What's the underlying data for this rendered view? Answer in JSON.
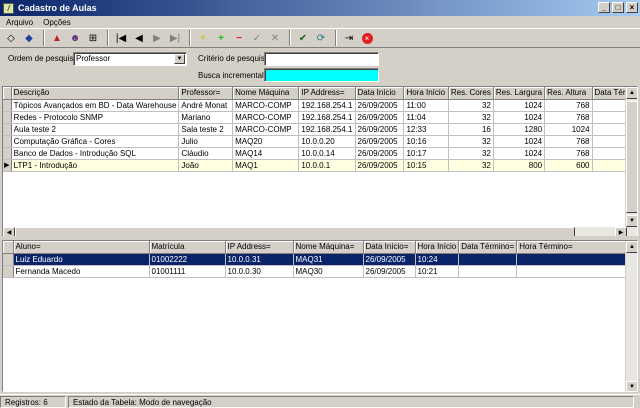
{
  "window": {
    "title": "Cadastro de Aulas"
  },
  "menu": [
    "Arquivo",
    "Opções"
  ],
  "filters": {
    "order_label": "Ordem de pesquisa:",
    "order_value": "Professor",
    "criteria_label": "Critério de pesquisa:",
    "criteria_value": "",
    "incremental_label": "Busca incremental:",
    "incremental_value": ""
  },
  "colors": {
    "incremental_bg": "#00ffff",
    "selection": "#0a246a",
    "current_row": "#ffffe1",
    "delete_icon": "#e02020",
    "add_icon": "#20c020"
  },
  "classes_grid": {
    "columns": [
      "Descrição",
      "Professor",
      "Nome Máquina",
      "IP Address",
      "Data Início",
      "Hora Início",
      "Res. Cores",
      "Res. Largura",
      "Res. Altura",
      "Data Térmi"
    ],
    "rows": [
      [
        "Tópicos Avançados em BD - Data Warehouse",
        "André Monat",
        "MARCO-COMP",
        "192.168.254.1",
        "26/09/2005",
        "11:00",
        "32",
        "1024",
        "768",
        ""
      ],
      [
        "Redes - Protocolo SNMP",
        "Mariano",
        "MARCO-COMP",
        "192.168.254.1",
        "26/09/2005",
        "11:04",
        "32",
        "1024",
        "768",
        ""
      ],
      [
        "Aula teste 2",
        "Sala teste 2",
        "MARCO-COMP",
        "192.168.254.1",
        "26/09/2005",
        "12:33",
        "16",
        "1280",
        "1024",
        ""
      ],
      [
        "Computação Gráfica - Cores",
        "Julio",
        "MAQ20",
        "10.0.0.20",
        "26/09/2005",
        "10:16",
        "32",
        "1024",
        "768",
        ""
      ],
      [
        "Banco de Dados - Introdução SQL",
        "Cláudio",
        "MAQ14",
        "10.0.0.14",
        "26/09/2005",
        "10:17",
        "32",
        "1024",
        "768",
        ""
      ],
      [
        "LTP1 - Introdução",
        "João",
        "MAQ1",
        "10.0.0.1",
        "26/09/2005",
        "10:15",
        "32",
        "800",
        "600",
        ""
      ]
    ],
    "current_row": 5
  },
  "students_grid": {
    "columns": [
      "Aluno",
      "Matrícula",
      "IP Address",
      "Nome Máquina",
      "Data Início",
      "Hora Início",
      "Data Término",
      "Hora Término"
    ],
    "rows": [
      [
        "Luiz Eduardo",
        "01002222",
        "10.0.0.31",
        "MAQ31",
        "26/09/2005",
        "10:24",
        "",
        ""
      ],
      [
        "Fernanda Macedo",
        "01001111",
        "10.0.0.30",
        "MAQ30",
        "26/09/2005",
        "10:21",
        "",
        ""
      ]
    ],
    "selected_row": 0
  },
  "status": {
    "records": "Registros: 6",
    "table_state": "Estado da Tabela: Modo de navegação"
  }
}
